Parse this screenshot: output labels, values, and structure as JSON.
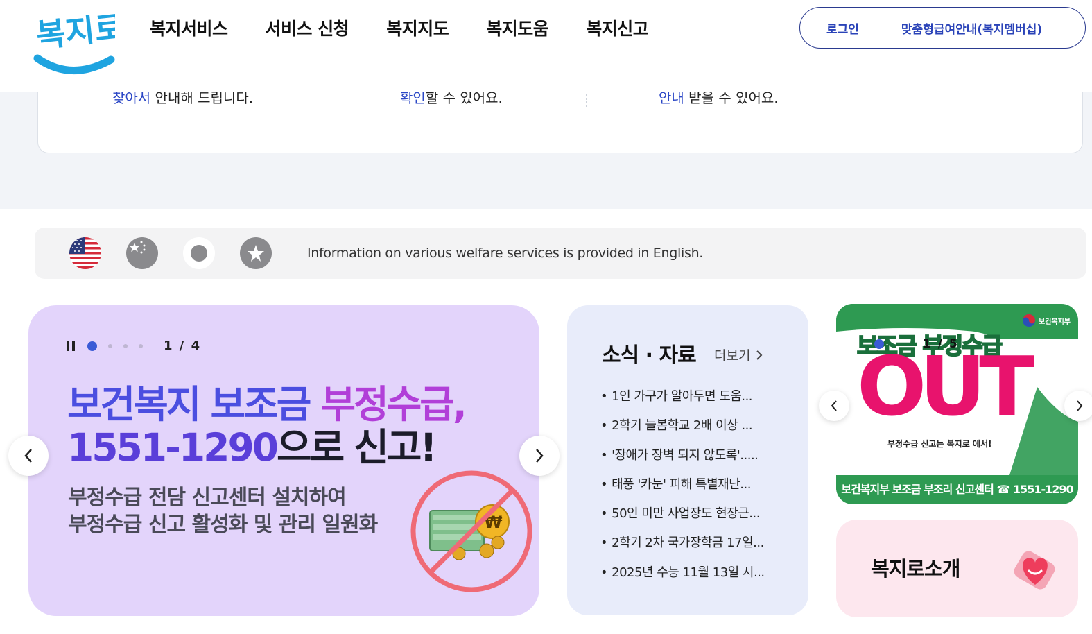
{
  "header": {
    "logo_text": "복지로",
    "nav": [
      "복지서비스",
      "서비스 신청",
      "복지지도",
      "복지도움",
      "복지신고"
    ],
    "login": "로그인",
    "membership": "맞춤형급여안내(복지멤버십)"
  },
  "prev_section": {
    "items": [
      {
        "highlight": "찾아서",
        "text": " 안내해 드립니다."
      },
      {
        "highlight": "확인",
        "text": "할 수 있어요."
      },
      {
        "highlight": "안내",
        "text": " 받을 수 있어요."
      }
    ]
  },
  "language_bar": {
    "text": "Information on various welfare services is provided in English.",
    "flags": [
      "us-flag",
      "china-flag",
      "japan-flag",
      "vietnam-flag"
    ]
  },
  "main_banner": {
    "counter": "1 / 4",
    "title_line1_a": "보건복지 보조금 ",
    "title_line1_b": "부정수급,",
    "title_line2_num": "1551-1290",
    "title_line2_rest": "으로 신고!",
    "sub_line1": "부정수급 전담 신고센터 설치하여",
    "sub_line2": "부정수급 신고 활성화 및 관리 일원화",
    "total_slides": 4,
    "current_slide": 1
  },
  "news": {
    "title": "소식 · 자료",
    "more": "더보기",
    "items": [
      "1인 가구가 알아두면 도움...",
      "2학기 늘봄학교 2배 이상 ...",
      "'장애가 장벽 되지 않도록'.....",
      "태풍 '카눈' 피해 특별재난...",
      "50인 미만 사업장도 현장근...",
      "2학기 2차 국가장학금 17일...",
      "2025년 수능 11월 13일 시..."
    ]
  },
  "promo": {
    "ministry": "보건복지부",
    "headline": "보조금 부정수급",
    "out": "OUT",
    "report_text": "부정수급 신고는 복지로 에서!",
    "bottom_bar": "보건복지부 보조금 부조리 신고센터 ☎ 1551-1290",
    "counter": "1 / 5"
  },
  "intro": {
    "label": "복지로소개"
  },
  "colors": {
    "accent": "#2a43b8",
    "banner_bg": "#e3d4fb",
    "news_bg": "#e8ecfa",
    "promo_green": "#2e9a52",
    "promo_pink": "#e8136d",
    "intro_bg": "#fde7ee"
  }
}
